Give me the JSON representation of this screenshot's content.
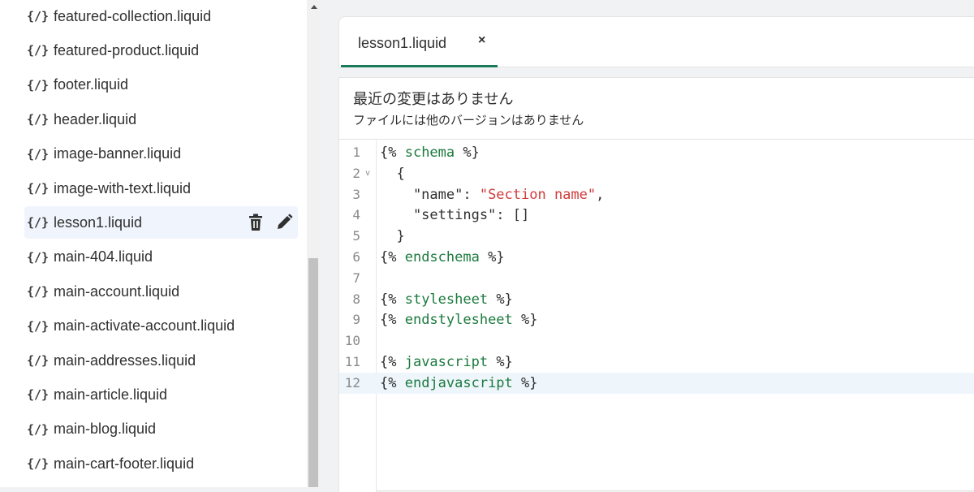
{
  "sidebar": {
    "files": [
      {
        "icon": "{/}",
        "label": "featured-collection.liquid"
      },
      {
        "icon": "{/}",
        "label": "featured-product.liquid"
      },
      {
        "icon": "{/}",
        "label": "footer.liquid"
      },
      {
        "icon": "{/}",
        "label": "header.liquid"
      },
      {
        "icon": "{/}",
        "label": "image-banner.liquid"
      },
      {
        "icon": "{/}",
        "label": "image-with-text.liquid"
      },
      {
        "icon": "{/}",
        "label": "lesson1.liquid",
        "active": true
      },
      {
        "icon": "{/}",
        "label": "main-404.liquid"
      },
      {
        "icon": "{/}",
        "label": "main-account.liquid"
      },
      {
        "icon": "{/}",
        "label": "main-activate-account.liquid"
      },
      {
        "icon": "{/}",
        "label": "main-addresses.liquid"
      },
      {
        "icon": "{/}",
        "label": "main-article.liquid"
      },
      {
        "icon": "{/}",
        "label": "main-blog.liquid"
      },
      {
        "icon": "{/}",
        "label": "main-cart-footer.liquid"
      }
    ],
    "active_row_actions": [
      "trash-icon",
      "pencil-icon"
    ]
  },
  "tab": {
    "label": "lesson1.liquid",
    "close": "×"
  },
  "notice": {
    "title": "最近の変更はありません",
    "subtitle": "ファイルには他のバージョンはありません"
  },
  "editor": {
    "lines": [
      {
        "n": "1",
        "fold": "",
        "tokens": [
          [
            "punc",
            "{% "
          ],
          [
            "kw",
            "schema"
          ],
          [
            "punc",
            " %}"
          ]
        ]
      },
      {
        "n": "2",
        "fold": "v",
        "tokens": [
          [
            "punc",
            "  {"
          ]
        ]
      },
      {
        "n": "3",
        "fold": "",
        "tokens": [
          [
            "punc",
            "    \"name\": "
          ],
          [
            "str",
            "\"Section name\""
          ],
          [
            "punc",
            ","
          ]
        ]
      },
      {
        "n": "4",
        "fold": "",
        "tokens": [
          [
            "punc",
            "    \"settings\": []"
          ]
        ]
      },
      {
        "n": "5",
        "fold": "",
        "tokens": [
          [
            "punc",
            "  }"
          ]
        ]
      },
      {
        "n": "6",
        "fold": "",
        "tokens": [
          [
            "punc",
            "{% "
          ],
          [
            "kw",
            "endschema"
          ],
          [
            "punc",
            " %}"
          ]
        ]
      },
      {
        "n": "7",
        "fold": "",
        "tokens": []
      },
      {
        "n": "8",
        "fold": "",
        "tokens": [
          [
            "punc",
            "{% "
          ],
          [
            "kw",
            "stylesheet"
          ],
          [
            "punc",
            " %}"
          ]
        ]
      },
      {
        "n": "9",
        "fold": "",
        "tokens": [
          [
            "punc",
            "{% "
          ],
          [
            "kw",
            "endstylesheet"
          ],
          [
            "punc",
            " %}"
          ]
        ]
      },
      {
        "n": "10",
        "fold": "",
        "tokens": []
      },
      {
        "n": "11",
        "fold": "",
        "tokens": [
          [
            "punc",
            "{% "
          ],
          [
            "kw",
            "javascript"
          ],
          [
            "punc",
            " %}"
          ]
        ]
      },
      {
        "n": "12",
        "fold": "",
        "tokens": [
          [
            "punc",
            "{% "
          ],
          [
            "kw",
            "endjavascript"
          ],
          [
            "punc",
            " %}"
          ]
        ],
        "active": true
      }
    ]
  },
  "colors": {
    "keyword": "#1b7a3e",
    "string": "#d13b3b",
    "tab_underline": "#1a7a5a",
    "active_row": "#f0f5fd"
  }
}
